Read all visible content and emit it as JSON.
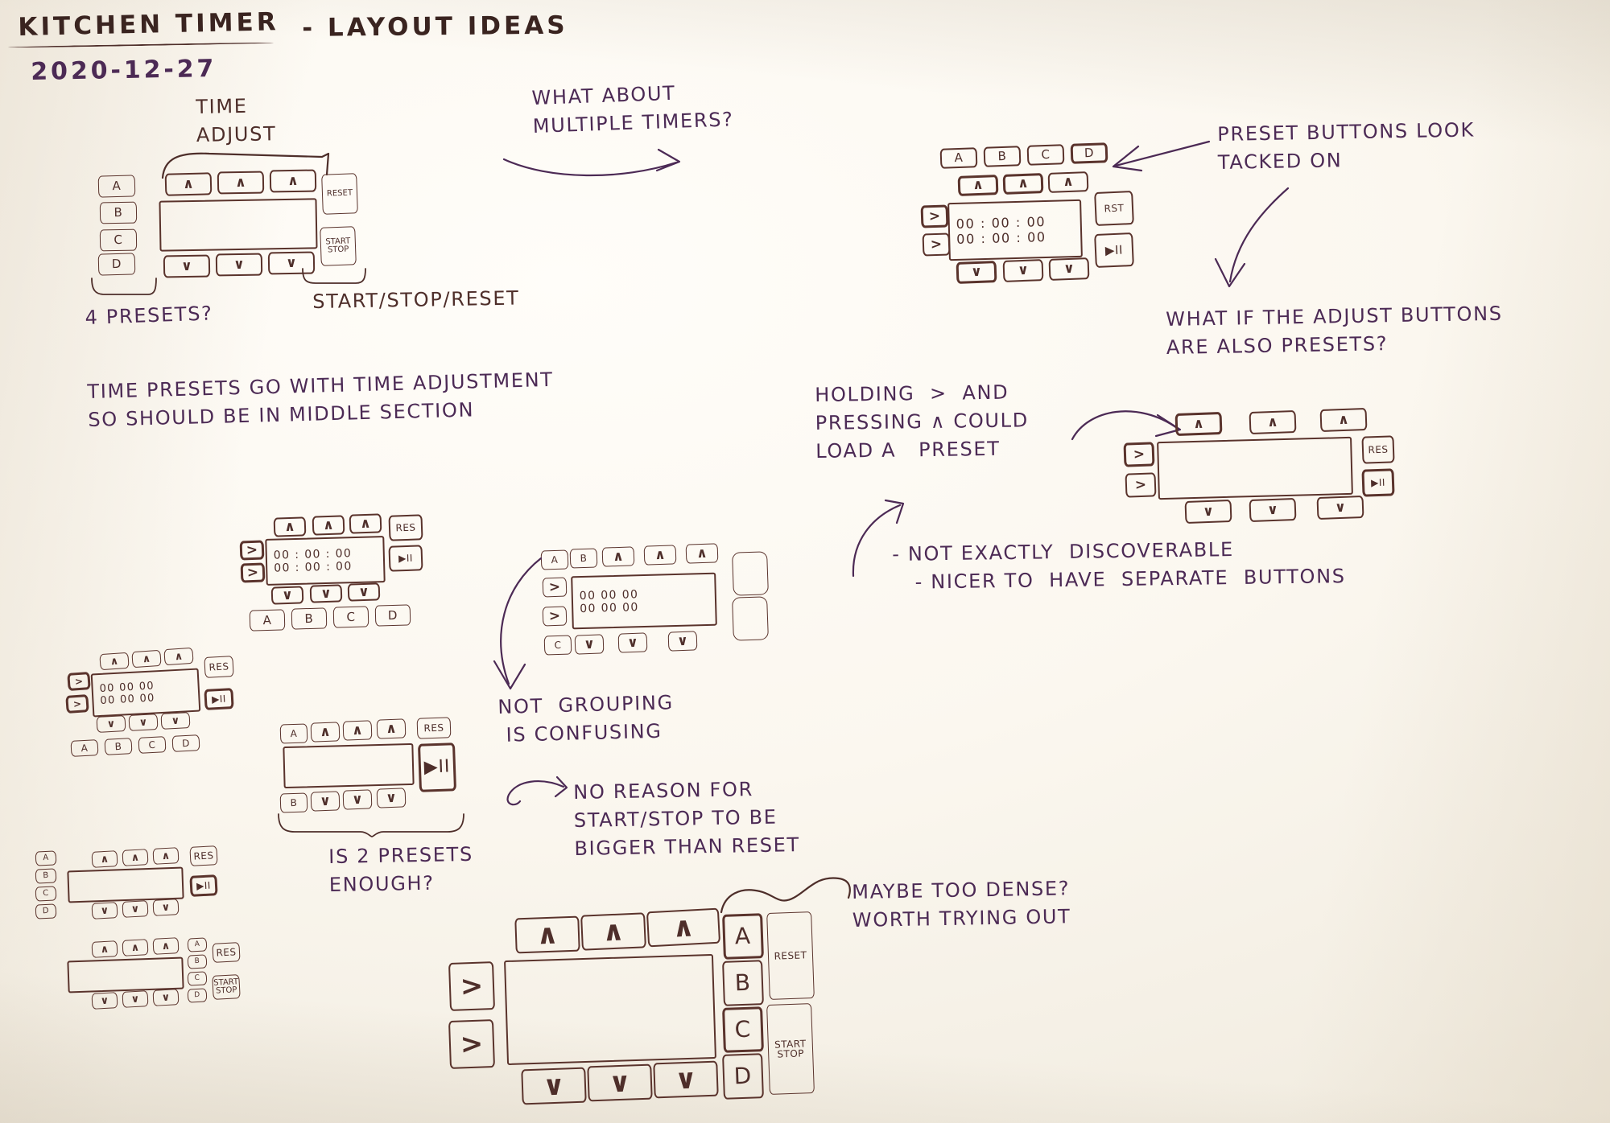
{
  "page": {
    "title": "KITCHEN TIMER",
    "title_suffix": "- LAYOUT IDEAS",
    "date": "2020-12-27",
    "ink_color": "#4e2e2a",
    "ink_color_alt": "#4c2a55",
    "paper_color": "#fbf8f2"
  },
  "labels": {
    "up": "∧",
    "down": "∨",
    "right": ">",
    "play_pause": "▶II",
    "reset_short": "RST",
    "reset_med": "RES",
    "reset_long": "RESET",
    "start_stop_1": "START",
    "start_stop_2": "STOP",
    "preset_a": "A",
    "preset_b": "B",
    "preset_c": "C",
    "preset_d": "D",
    "time_zero": "00 : 00 : 00"
  },
  "annotations": {
    "time_adjust": "TIME\nADJUST",
    "multiple_timers": "WHAT ABOUT\nMULTIPLE TIMERS?",
    "four_presets": "4 PRESETS?",
    "start_stop_reset": "START/STOP/RESET",
    "preset_tacked_on": "PRESET BUTTONS LOOK\nTACKED ON",
    "adjust_also_presets": "WHAT IF THE ADJUST BUTTONS\nARE ALSO PRESETS?",
    "middle_section": "TIME PRESETS GO WITH TIME ADJUSTMENT\nSO SHOULD BE IN MIDDLE SECTION",
    "holding_right": "HOLDING  >  AND\nPRESSING ∧ COULD\nLOAD A   PRESET",
    "not_discoverable": "- NOT EXACTLY  DISCOVERABLE\n   - NICER TO  HAVE  SEPARATE  BUTTONS",
    "not_grouping": "NOT  GROUPING\n IS CONFUSING",
    "no_reason_bigger": "NO REASON FOR\nSTART/STOP TO BE\nBIGGER THAN RESET",
    "two_presets_enough": "IS 2 PRESETS\nENOUGH?",
    "too_dense": "MAYBE TOO DENSE?\nWORTH TRYING OUT"
  },
  "sketches": [
    {
      "id": "sketch-1-basic",
      "name": "basic-layout-four-presets",
      "presets": [
        "A",
        "B",
        "C",
        "D"
      ],
      "up_buttons": 3,
      "down_buttons": 3,
      "right_buttons": 0,
      "side_buttons": [
        "RESET",
        "START\nSTOP"
      ],
      "display_lines": []
    },
    {
      "id": "sketch-2-top-right",
      "name": "presets-above-adjust",
      "presets": [
        "A",
        "B",
        "C",
        "D"
      ],
      "up_buttons": 3,
      "down_buttons": 3,
      "right_buttons": 2,
      "side_buttons": [
        "RST",
        "▶II"
      ],
      "display_lines": [
        "00 : 00 : 00",
        "00 : 00 : 00"
      ]
    },
    {
      "id": "sketch-3-adjust-as-preset",
      "name": "adjust-buttons-are-presets",
      "presets": [],
      "up_buttons": 3,
      "down_buttons": 3,
      "right_buttons": 2,
      "side_buttons": [
        "RES",
        "▶II"
      ],
      "display_lines": []
    },
    {
      "id": "sketch-4-presets-below",
      "name": "presets-row-below-display",
      "presets": [
        "A",
        "B",
        "C",
        "D"
      ],
      "up_buttons": 3,
      "down_buttons": 3,
      "right_buttons": 2,
      "side_buttons": [
        "RES",
        "▶II"
      ],
      "display_lines": [
        "00 : 00 : 00",
        "00 : 00 : 00"
      ]
    },
    {
      "id": "sketch-5-left-dense",
      "name": "dense-left-variant",
      "presets": [
        "A",
        "B",
        "C",
        "D"
      ],
      "up_buttons": 3,
      "down_buttons": 3,
      "right_buttons": 2,
      "side_buttons": [
        "RES",
        "▶II"
      ],
      "display_lines": [
        "00 00 00",
        "00 00 00"
      ]
    },
    {
      "id": "sketch-6-mixed-presets",
      "name": "presets-inline-with-adjust",
      "presets": [
        "A",
        "B"
      ],
      "up_buttons": 3,
      "down_buttons": 3,
      "right_buttons": 2,
      "side_buttons": [],
      "display_lines": [
        "00  00  00",
        "00  00  00"
      ]
    },
    {
      "id": "sketch-7-two-presets",
      "name": "two-presets-big-start-stop",
      "presets": [
        "A",
        "B"
      ],
      "up_buttons": 3,
      "down_buttons": 3,
      "right_buttons": 0,
      "side_buttons": [
        "RES",
        "▶II"
      ],
      "display_lines": []
    },
    {
      "id": "sketch-8-small-a",
      "name": "small-variant-presets-left",
      "presets": [
        "A",
        "B",
        "C",
        "D"
      ],
      "up_buttons": 3,
      "down_buttons": 3,
      "right_buttons": 0,
      "side_buttons": [
        "RES",
        "▶II"
      ],
      "display_lines": []
    },
    {
      "id": "sketch-9-small-b",
      "name": "small-variant-presets-right",
      "presets": [
        "A",
        "B",
        "C",
        "D"
      ],
      "up_buttons": 3,
      "down_buttons": 3,
      "right_buttons": 0,
      "side_buttons": [
        "RES",
        "START\nSTOP"
      ],
      "display_lines": []
    },
    {
      "id": "sketch-10-dense-final",
      "name": "dense-final-layout",
      "presets": [
        "A",
        "B",
        "C",
        "D"
      ],
      "up_buttons": 3,
      "down_buttons": 3,
      "right_buttons": 2,
      "side_buttons": [
        "RESET",
        "START\nSTOP"
      ],
      "display_lines": []
    }
  ]
}
